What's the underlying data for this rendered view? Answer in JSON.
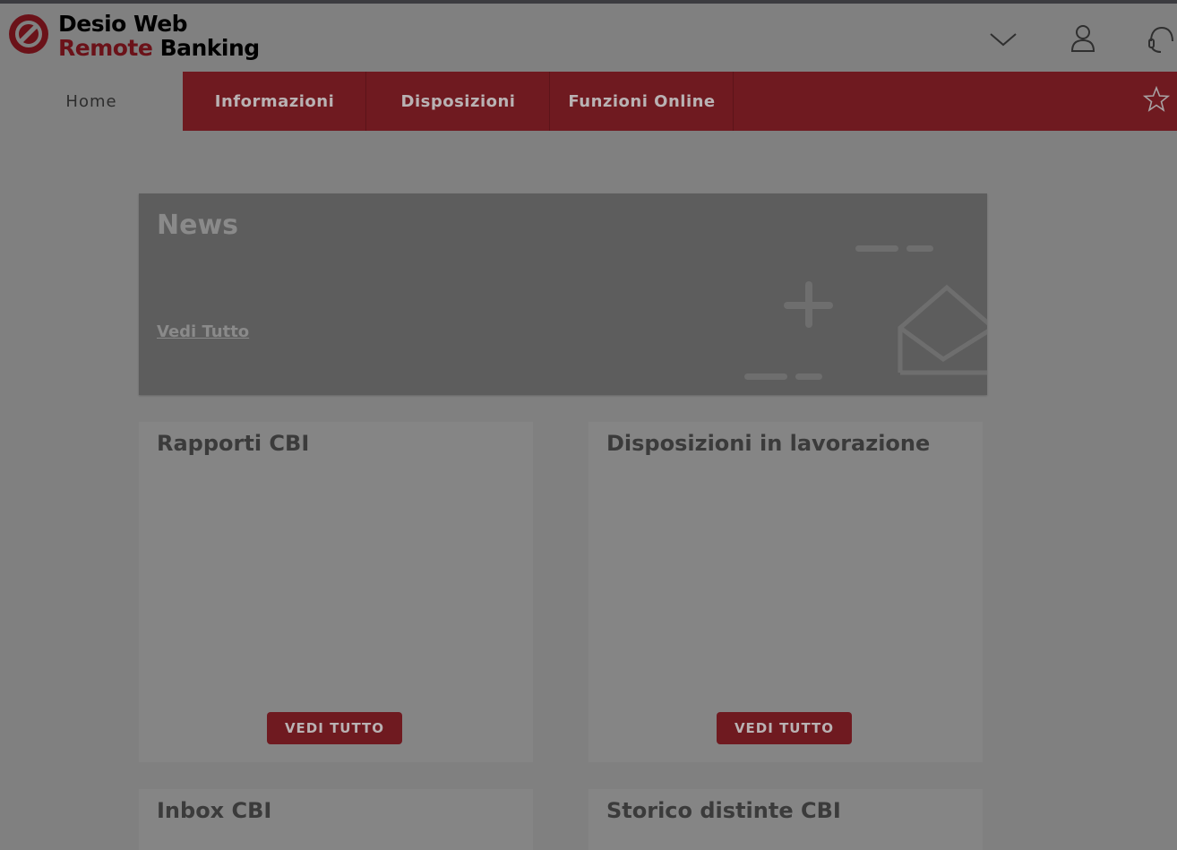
{
  "brand": {
    "line1": "Desio Web",
    "line2_part1": "Remote",
    "line2_part2": "Banking",
    "accent_color": "#6b1219"
  },
  "header_icons": [
    "chevron-down-icon",
    "user-icon",
    "headset-icon"
  ],
  "nav": {
    "home": "Home",
    "items": [
      "Informazioni",
      "Disposizioni",
      "Funzioni Online"
    ],
    "favorite_icon": "star-icon"
  },
  "news": {
    "title": "News",
    "link": "Vedi Tutto"
  },
  "cards": [
    {
      "title": "Rapporti CBI",
      "button": "VEDI TUTTO"
    },
    {
      "title": "Disposizioni in lavorazione",
      "button": "VEDI TUTTO"
    },
    {
      "title": "Inbox CBI"
    },
    {
      "title": "Storico distinte CBI"
    }
  ]
}
